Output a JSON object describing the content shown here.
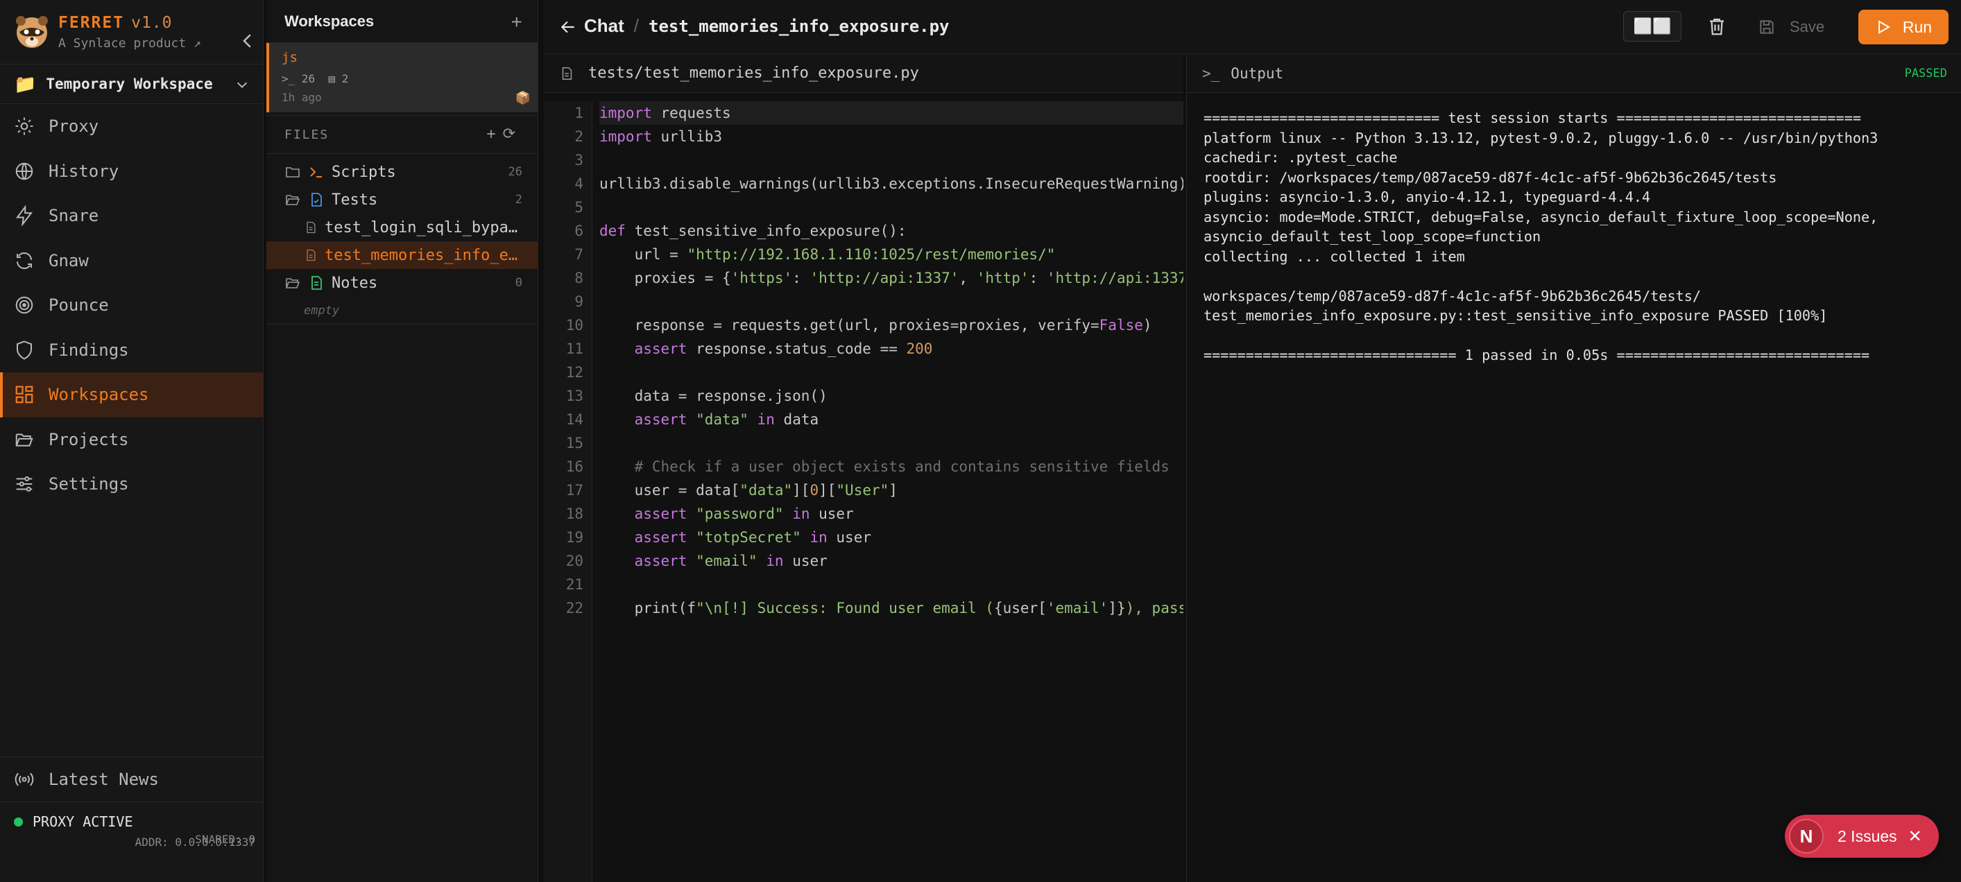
{
  "sidebar": {
    "brand": {
      "name": "FERRET",
      "version": "v1.0",
      "subtitle": "A Synlace product ↗"
    },
    "workspace_selector": {
      "icon": "📁",
      "label": "Temporary Workspace"
    },
    "nav": [
      {
        "label": "Proxy",
        "icon": "gear-icon",
        "active": false
      },
      {
        "label": "History",
        "icon": "globe-icon",
        "active": false
      },
      {
        "label": "Snare",
        "icon": "lightning-icon",
        "active": false
      },
      {
        "label": "Gnaw",
        "icon": "refresh-icon",
        "active": false
      },
      {
        "label": "Pounce",
        "icon": "target-icon",
        "active": false
      },
      {
        "label": "Findings",
        "icon": "shield-icon",
        "active": false
      },
      {
        "label": "Workspaces",
        "icon": "grid-icon",
        "active": true
      },
      {
        "label": "Projects",
        "icon": "folder-open-icon",
        "active": false
      },
      {
        "label": "Settings",
        "icon": "sliders-icon",
        "active": false
      }
    ],
    "news": {
      "label": "Latest News",
      "icon": "broadcast-icon"
    },
    "proxy_status": {
      "status": "PROXY ACTIVE",
      "addr": "ADDR: 0.0.0.0:1337",
      "snared": "SNARED: 0",
      "color": "#22c55e"
    }
  },
  "workspaces_panel": {
    "title": "Workspaces",
    "card": {
      "name": "js",
      "scripts_count": "26",
      "tests_count": "2",
      "ago": "1h ago"
    },
    "files_header": "FILES",
    "tree": {
      "scripts": {
        "label": "Scripts",
        "count": "26"
      },
      "tests": {
        "label": "Tests",
        "count": "2",
        "children": [
          "test_login_sqli_bypass.py",
          "test_memories_info_exposure.py"
        ]
      },
      "notes": {
        "label": "Notes",
        "count": "0",
        "empty": "empty"
      }
    }
  },
  "topbar": {
    "back_label": "Chat",
    "separator": "/",
    "filename": "test_memories_info_exposure.py",
    "layout_label": "⬜⬜",
    "save_label": "Save",
    "run_label": "Run"
  },
  "editor": {
    "tab_path": "tests/test_memories_info_exposure.py",
    "line_numbers": [
      "1",
      "2",
      "3",
      "4",
      "5",
      "6",
      "7",
      "8",
      "9",
      "10",
      "11",
      "12",
      "13",
      "14",
      "15",
      "16",
      "17",
      "18",
      "19",
      "20",
      "21",
      "22"
    ]
  },
  "output": {
    "title": "Output",
    "status": "PASSED",
    "lines": [
      "============================ test session starts =============================",
      "platform linux -- Python 3.13.12, pytest-9.0.2, pluggy-1.6.0 -- /usr/bin/python3",
      "cachedir: .pytest_cache",
      "rootdir: /workspaces/temp/087ace59-d87f-4c1c-af5f-9b62b36c2645/tests",
      "plugins: asyncio-1.3.0, anyio-4.12.1, typeguard-4.4.4",
      "asyncio: mode=Mode.STRICT, debug=False, asyncio_default_fixture_loop_scope=None,",
      "asyncio_default_test_loop_scope=function",
      "collecting ... collected 1 item",
      "",
      "workspaces/temp/087ace59-d87f-4c1c-af5f-9b62b36c2645/tests/",
      "test_memories_info_exposure.py::test_sensitive_info_exposure PASSED [100%]",
      "",
      "============================== 1 passed in 0.05s =============================="
    ]
  },
  "issues": {
    "avatar": "N",
    "label": "2 Issues",
    "close": "✕"
  }
}
